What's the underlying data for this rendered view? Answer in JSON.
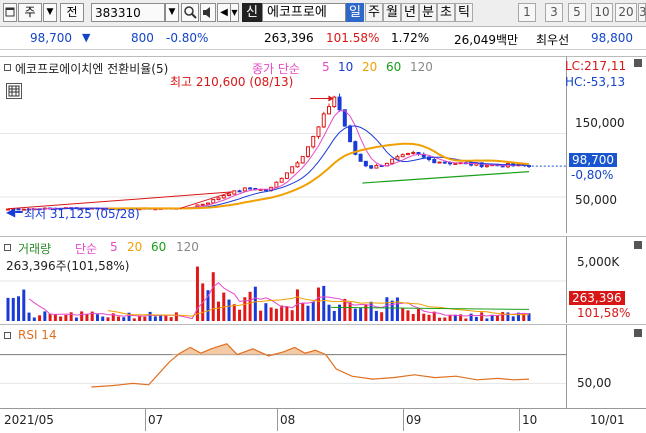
{
  "toolbar": {
    "market_label": "주",
    "mode_label": "전",
    "code_value": "383310",
    "name_label": "에코프로에",
    "signal_label": "신",
    "period_tabs": [
      {
        "label": "일",
        "selected": true
      },
      {
        "label": "주",
        "selected": false
      },
      {
        "label": "월",
        "selected": false
      },
      {
        "label": "년",
        "selected": false
      },
      {
        "label": "분",
        "selected": false
      },
      {
        "label": "초",
        "selected": false
      },
      {
        "label": "틱",
        "selected": false
      }
    ],
    "interval_buttons": [
      "1",
      "3",
      "5",
      "10",
      "20",
      "3"
    ]
  },
  "price_bar": {
    "price": "98,700",
    "change": "800",
    "change_pct": "-0.80%",
    "volume": "263,396",
    "volume_ratio": "101.58%",
    "turnover": "1.72%",
    "amount": "26,049백만",
    "best_bid_label": "최우선",
    "best_bid": "98,800",
    "colors": {
      "down": "#1445c8",
      "up": "#d81616"
    }
  },
  "price_panel": {
    "title": "에코프로에이치엔 전환비율(5)",
    "ma_label": "종가 단순",
    "ma_periods": [
      "5",
      "10",
      "20",
      "60",
      "120"
    ],
    "ma_colors": [
      "#e64ac8",
      "#1a3ad8",
      "#f0a000",
      "#19a019",
      "#888888"
    ],
    "lc_label": "LC:217,11",
    "hc_label": "HC:-53,13",
    "high_annotation": "최고 210,600 (08/13)",
    "low_annotation": "최저 31,125 (05/28)",
    "ticks": [
      "150,000",
      "50,000"
    ],
    "current_price": "98,700",
    "current_change": "-0,80%"
  },
  "volume_panel": {
    "title": "거래량",
    "ma_label": "단순",
    "ma_periods": [
      "5",
      "20",
      "60",
      "120"
    ],
    "ma_colors": [
      "#e64ac8",
      "#f0a000",
      "#19a019",
      "#888888"
    ],
    "value_label": "263,396주(101,58%)",
    "ticks": [
      "5,000K"
    ],
    "current_volume": "263,396",
    "current_ratio": "101,58%"
  },
  "rsi_panel": {
    "title": "RSI 14",
    "ticks": [
      "50,00"
    ]
  },
  "date_axis": [
    "2021/05",
    "07",
    "08",
    "09",
    "10",
    "10/01"
  ],
  "chart_data": {
    "type": "line",
    "title": "에코프로에이치엔 전환비율(5)",
    "x": [
      "2021/05",
      "07",
      "08",
      "09",
      "10"
    ],
    "series": [
      {
        "name": "종가",
        "values": [
          31125,
          37000,
          60000,
          120000,
          210600,
          140000,
          110000,
          105000,
          100000,
          98700
        ]
      }
    ],
    "annotations": [
      "최고 210,600 (08/13)",
      "최저 31,125 (05/28)"
    ],
    "y_ticks": [
      "150,000",
      "50,000"
    ]
  }
}
